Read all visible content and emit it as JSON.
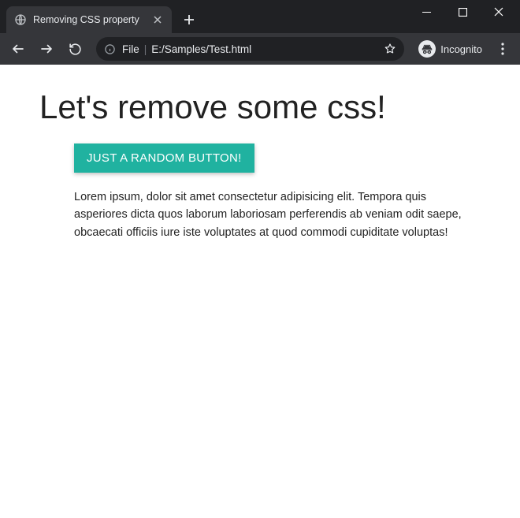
{
  "window": {
    "tab_title": "Removing CSS property"
  },
  "toolbar": {
    "address_scheme": "File",
    "address_path": "E:/Samples/Test.html",
    "incognito_label": "Incognito"
  },
  "page": {
    "heading": "Let's remove some css!",
    "button_label": "JUST A RANDOM BUTTON!",
    "paragraph": "Lorem ipsum, dolor sit amet consectetur adipisicing elit. Tempora quis asperiores dicta quos laborum laboriosam perferendis ab veniam odit saepe, obcaecati officiis iure iste voluptates at quod commodi cupiditate voluptas!"
  }
}
